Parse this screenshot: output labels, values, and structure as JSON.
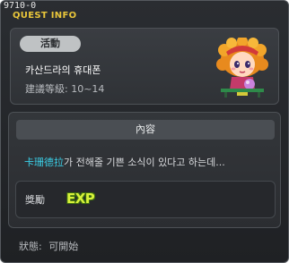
{
  "window": {
    "id_text": "9710-0",
    "title": "QUEST INFO"
  },
  "quest": {
    "badge": "活動",
    "name": "카산드라의 휴대폰",
    "level": "建議等級: 10~14",
    "npc_icon": "npc-portrait-icon"
  },
  "content": {
    "header": "內容",
    "npc_name": "卡珊德拉",
    "description_rest": "가 전해줄 기쁜 소식이 있다고 하는데..."
  },
  "reward": {
    "label": "獎勵",
    "exp_text": "EXP"
  },
  "status": {
    "label": "狀態:",
    "value": "可開始"
  },
  "colors": {
    "title": "#e9c63a",
    "npc_highlight": "#3ad0e8",
    "exp": "#d8f23a"
  }
}
